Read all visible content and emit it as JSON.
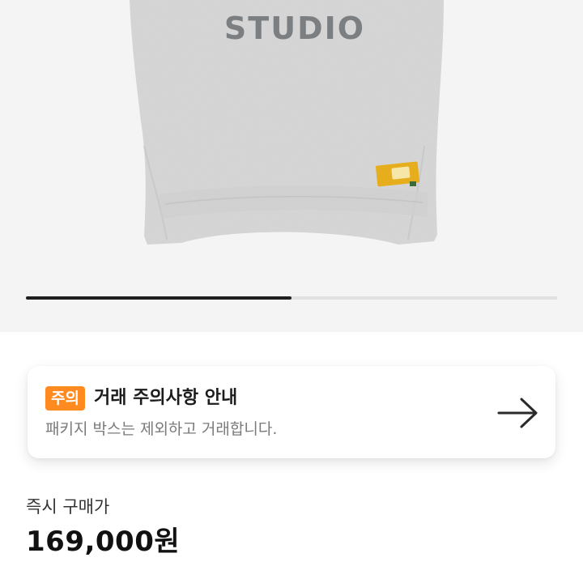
{
  "product": {
    "print_text": "STUDIO",
    "image_count_progress": 0.5
  },
  "notice": {
    "badge": "주의",
    "title": "거래 주의사항 안내",
    "description": "패키지 박스는 제외하고 거래합니다.",
    "icon": "arrow-right-icon",
    "accent_color": "#ff8a1f"
  },
  "price": {
    "label": "즉시 구매가",
    "value": "169,000원"
  }
}
